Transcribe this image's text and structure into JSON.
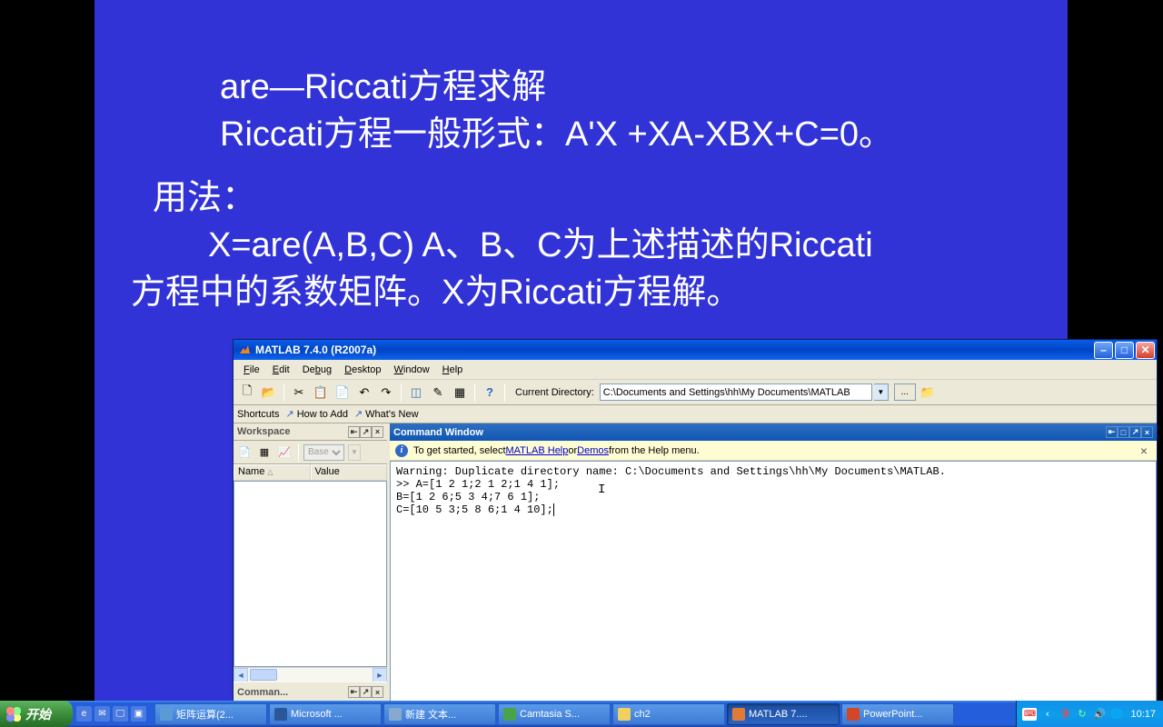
{
  "slide": {
    "line1": "are—Riccati方程求解",
    "line2": "Riccati方程一般形式：A'X +XA-XBX+C=0。",
    "line3": "用法：",
    "line4": "X=are(A,B,C)  A、B、C为上述描述的Riccati",
    "line5": "方程中的系数矩阵。X为Riccati方程解。"
  },
  "matlab": {
    "title": "MATLAB  7.4.0 (R2007a)",
    "menu": {
      "file": "File",
      "edit": "Edit",
      "debug": "Debug",
      "desktop": "Desktop",
      "window": "Window",
      "help": "Help"
    },
    "toolbar": {
      "curdir_label": "Current Directory:",
      "curdir_value": "C:\\Documents and Settings\\hh\\My Documents\\MATLAB",
      "dots": "..."
    },
    "shortcuts": {
      "label": "Shortcuts",
      "howto": "How to Add",
      "whatsnew": "What's New"
    },
    "workspace": {
      "title": "Workspace",
      "base": "Base",
      "col_name": "Name",
      "col_value": "Value"
    },
    "commandHistoryTitle": "Comman...",
    "cmdwin": {
      "title": "Command Window",
      "hint_pre": "To get started, select ",
      "hint_link1": "MATLAB Help",
      "hint_mid": " or ",
      "hint_link2": "Demos",
      "hint_post": " from the Help menu.",
      "line1": "Warning: Duplicate directory name: C:\\Documents and Settings\\hh\\My Documents\\MATLAB.",
      "line2": ">> A=[1 2 1;2 1 2;1 4 1];",
      "line3": "B=[1 2 6;5 3 4;7 6 1];",
      "line4": "C=[10 5 3;5 8 6;1 4 10];"
    }
  },
  "taskbar": {
    "start": "开始",
    "items": [
      {
        "label": "矩阵运算(2...",
        "color": "#5b9bd5"
      },
      {
        "label": "Microsoft ...",
        "color": "#2b579a"
      },
      {
        "label": "新建 文本...",
        "color": "#87a9d0"
      },
      {
        "label": "Camtasia S...",
        "color": "#49a349"
      },
      {
        "label": "ch2",
        "color": "#f0d060"
      },
      {
        "label": "MATLAB  7....",
        "color": "#e07a37",
        "active": true
      },
      {
        "label": "PowerPoint...",
        "color": "#d24726"
      }
    ],
    "time": "10:17"
  }
}
